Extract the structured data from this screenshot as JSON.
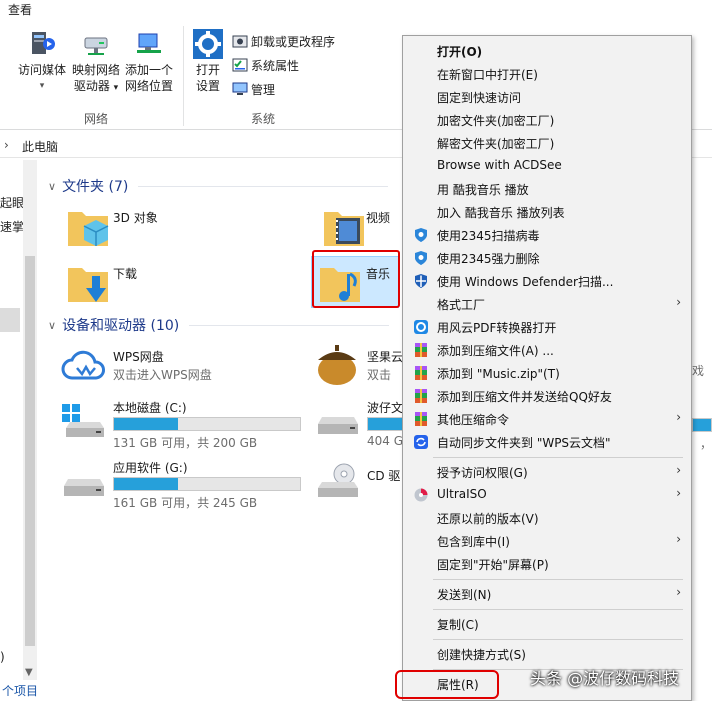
{
  "ribbon": {
    "tab_view": "查看",
    "btn_media": "访问媒体",
    "btn_map_line1": "映射网络",
    "btn_map_line2": "驱动器",
    "btn_addloc_line1": "添加一个",
    "btn_addloc_line2": "网络位置",
    "group_network": "网络",
    "btn_open_line1": "打开",
    "btn_open_line2": "设置",
    "small_uninstall": "卸载或更改程序",
    "small_sysprops": "系统属性",
    "small_manage": "管理",
    "group_system": "系统"
  },
  "address": {
    "crumb": "此电脑"
  },
  "nav": {
    "item1": "起眼",
    "item2": "速掌",
    "status": "个项目"
  },
  "content": {
    "folders_header": "文件夹 (7)",
    "folders": {
      "obj3d": "3D 对象",
      "video": "视频",
      "downloads": "下载",
      "music": "音乐"
    },
    "devices_header": "设备和驱动器 (10)",
    "wps": {
      "name": "WPS网盘",
      "sub": "双击进入WPS网盘"
    },
    "nut": {
      "name": "坚果云",
      "sub": "双击"
    },
    "drive_c": {
      "name": "本地磁盘 (C:)",
      "sub": "131 GB 可用，共 200 GB",
      "used": 0.345
    },
    "drive_bo": {
      "name": "波仔文",
      "sub": "404 G"
    },
    "drive_g": {
      "name": "应用软件 (G:)",
      "sub": "161 GB 可用，共 245 GB",
      "used": 0.343
    },
    "drive_cd": {
      "name": "CD 驱"
    }
  },
  "menu": {
    "open": "打开(O)",
    "open_new": "在新窗口中打开(E)",
    "pin_quick": "固定到快速访问",
    "encrypt": "加密文件夹(加密工厂)",
    "decrypt": "解密文件夹(加密工厂)",
    "acdsee": "Browse with ACDSee",
    "kuwo_play": "用 酷我音乐 播放",
    "kuwo_list": "加入 酷我音乐 播放列表",
    "scan2345": "使用2345扫描病毒",
    "del2345": "使用2345强力删除",
    "defender": "使用 Windows Defender扫描...",
    "format_factory": "格式工厂",
    "fengyun": "用风云PDF转换器打开",
    "add_archive": "添加到压缩文件(A) ...",
    "add_zip": "添加到 \"Music.zip\"(T)",
    "add_qq": "添加到压缩文件并发送给QQ好友",
    "other_compress": "其他压缩命令",
    "wps_sync": "自动同步文件夹到 \"WPS云文档\"",
    "grant": "授予访问权限(G)",
    "ultraiso": "UltraISO",
    "restore": "还原以前的版本(V)",
    "include_lib": "包含到库中(I)",
    "pin_start": "固定到\"开始\"屏幕(P)",
    "send_to": "发送到(N)",
    "copy": "复制(C)",
    "create_shortcut": "创建快捷方式(S)",
    "properties": "属性(R)"
  },
  "watermark": "头条 @波仔数码科技"
}
